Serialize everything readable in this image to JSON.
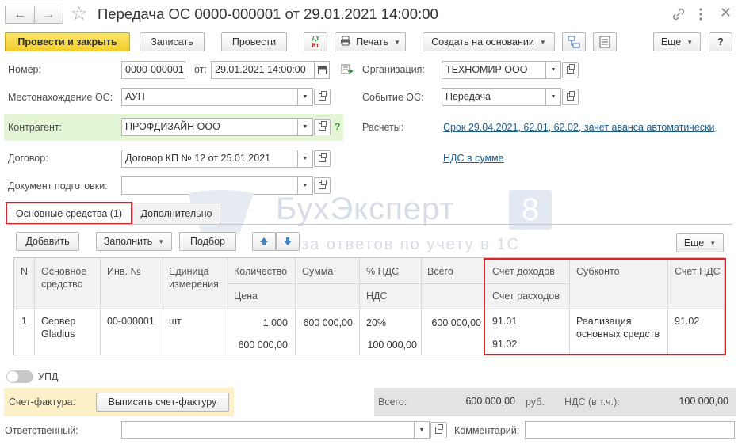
{
  "window": {
    "title": "Передача ОС 0000-000001 от 29.01.2021 14:00:00"
  },
  "toolbar": {
    "post_close": "Провести и закрыть",
    "save": "Записать",
    "post": "Провести",
    "dt_kt_icon_top": "Дт",
    "dt_kt_icon_bottom": "Кт",
    "print": "Печать",
    "create_based": "Создать на основании",
    "more": "Еще",
    "help": "?"
  },
  "form": {
    "number_label": "Номер:",
    "number_value": "0000-000001",
    "date_label": "от:",
    "date_value": "29.01.2021 14:00:00",
    "org_label": "Организация:",
    "org_value": "ТЕХНОМИР ООО",
    "location_label": "Местонахождение ОС:",
    "location_value": "АУП",
    "event_label": "Событие ОС:",
    "event_value": "Передача",
    "contractor_label": "Контрагент:",
    "contractor_value": "ПРОФДИЗАЙН ООО",
    "help_mark": "?",
    "settlements_label": "Расчеты:",
    "settlements_link": "Срок 29.04.2021, 62.01, 62.02, зачет аванса автоматически",
    "contract_label": "Договор:",
    "contract_value": "Договор КП № 12 от 25.01.2021",
    "vat_link": "НДС в сумме",
    "prep_doc_label": "Документ подготовки:",
    "prep_doc_value": ""
  },
  "tabs": [
    {
      "label": "Основные средства (1)"
    },
    {
      "label": "Дополнительно"
    }
  ],
  "watermark": {
    "brand": "БухЭксперт",
    "brand_num": "8",
    "tagline": "База ответов по учету в 1С"
  },
  "table_toolbar": {
    "add": "Добавить",
    "fill": "Заполнить",
    "select": "Подбор",
    "more": "Еще"
  },
  "table": {
    "headers": {
      "n": "N",
      "asset": "Основное средство",
      "inv": "Инв. №",
      "unit": "Единица измерения",
      "qty": "Количество",
      "price": "Цена",
      "sum": "Сумма",
      "vat_pct": "% НДС",
      "vat": "НДС",
      "total": "Всего",
      "income_acc": "Счет доходов",
      "expense_acc": "Счет расходов",
      "subconto": "Субконто",
      "vat_acc": "Счет НДС"
    },
    "rows": [
      {
        "n": "1",
        "asset": "Сервер Gladius",
        "inv": "00-000001",
        "unit": "шт",
        "qty": "1,000",
        "price": "600 000,00",
        "sum": "600 000,00",
        "vat_pct": "20%",
        "vat": "100 000,00",
        "total": "600 000,00",
        "income_acc": "91.01",
        "expense_acc": "91.02",
        "subconto": "Реализация основных средств",
        "vat_acc": "91.02"
      }
    ]
  },
  "footer": {
    "upd_label": "УПД",
    "invoice_label": "Счет-фактура:",
    "invoice_button": "Выписать счет-фактуру",
    "total_label": "Всего:",
    "total_value": "600 000,00",
    "currency": "руб.",
    "vat_incl_label": "НДС (в т.ч.):",
    "vat_incl_value": "100 000,00",
    "responsible_label": "Ответственный:",
    "responsible_value": "",
    "comment_label": "Комментарий:",
    "comment_value": ""
  },
  "colors": {
    "primary_button": "#f5d63d",
    "highlight_green": "#e4f6d6",
    "highlight_yellow": "#fbf0c8",
    "red_frame": "#d9232e",
    "link": "#1a5b94"
  }
}
